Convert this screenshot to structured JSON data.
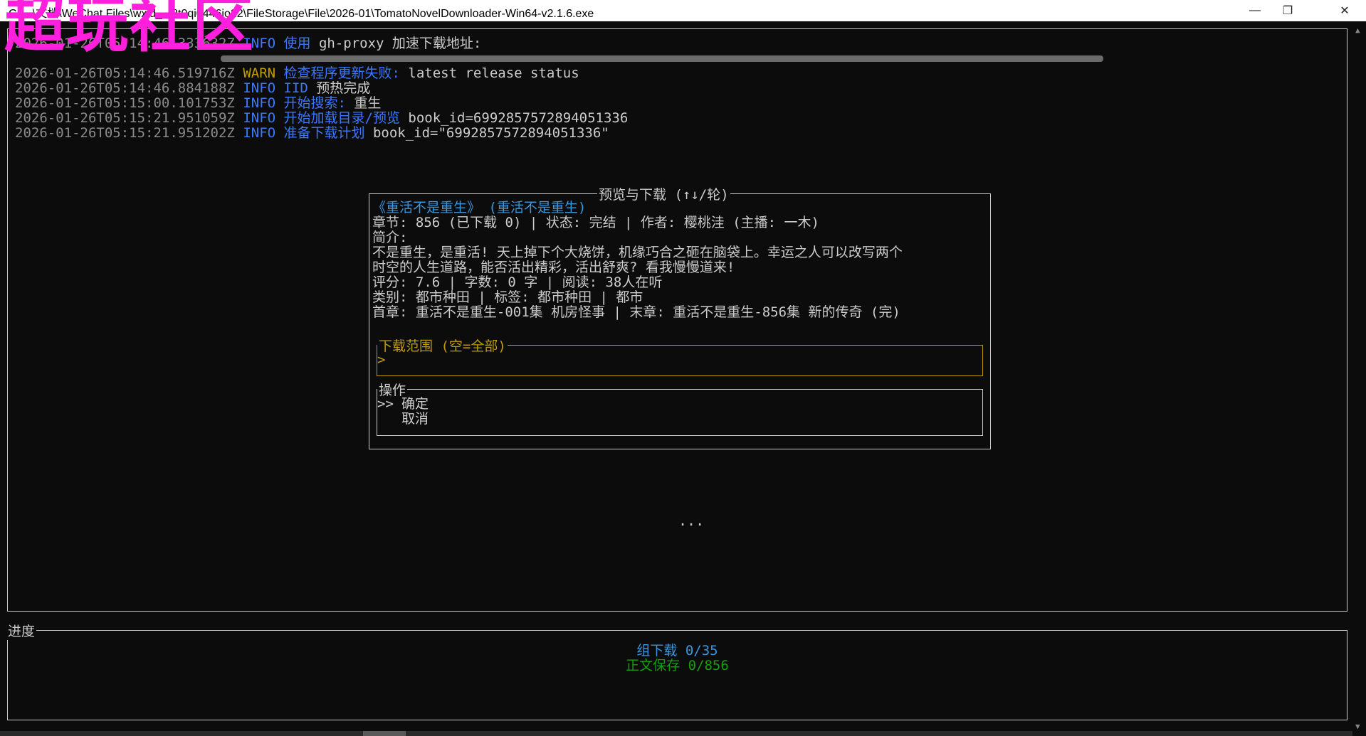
{
  "window": {
    "title": "C:\\...\\文档\\WeChat Files\\wxid_...8t0qi0446io22\\FileStorage\\File\\2026-01\\TomatoNovelDownloader-Win64-v2.1.6.exe",
    "minimize": "—",
    "restore": "❐",
    "close": "✕"
  },
  "watermark": "超玩社区",
  "log": [
    {
      "ts": "2026-01-26T05:14:46.333632Z",
      "level": "INFO",
      "msg": "使用",
      "detail": " gh-proxy 加速下载地址:"
    },
    {
      "ts": "2026-01-26T05:14:46.519716Z",
      "level": "WARN",
      "msg": "检查程序更新失败:",
      "detail": " latest release status"
    },
    {
      "ts": "2026-01-26T05:14:46.884188Z",
      "level": "INFO",
      "msg": "IID",
      "detail": " 预热完成"
    },
    {
      "ts": "2026-01-26T05:15:00.101753Z",
      "level": "INFO",
      "msg": "开始搜索:",
      "detail": " 重生"
    },
    {
      "ts": "2026-01-26T05:15:21.951059Z",
      "level": "INFO",
      "msg": "开始加载目录/预览",
      "detail": " book_id=6992857572894051336"
    },
    {
      "ts": "2026-01-26T05:15:21.951202Z",
      "level": "INFO",
      "msg": "准备下载计划",
      "detail": " book_id=\"6992857572894051336\""
    }
  ],
  "dialog": {
    "title": "预览与下载 (↑↓/轮)",
    "book_title": "《重活不是重生》 (重活不是重生)",
    "meta": "章节: 856 (已下载 0) | 状态: 完结 | 作者: 樱桃洼 (主播: 一木)",
    "intro_label": "简介:",
    "intro_1": "不是重生，是重活! 天上掉下个大烧饼，机缘巧合之砸在脑袋上。幸运之人可以改写两个",
    "intro_2": "时空的人生道路，能否活出精彩，活出舒爽? 看我慢慢道来!",
    "stats": "评分: 7.6 | 字数: 0 字 | 阅读: 38人在听",
    "category": "类别: 都市种田 | 标签: 都市种田 | 都市",
    "chapters": "首章: 重活不是重生-001集 机房怪事 | 末章: 重活不是重生-856集 新的传奇 (完)",
    "range_title": "下载范围 (空=全部)",
    "range_prompt": ">",
    "ops_title": "操作",
    "ops_cursor": ">>",
    "ops_confirm": "确定",
    "ops_cancel": "取消"
  },
  "ellipsis": "...",
  "progress": {
    "title": "进度",
    "group": "组下载 0/35",
    "save": "正文保存 0/856"
  }
}
